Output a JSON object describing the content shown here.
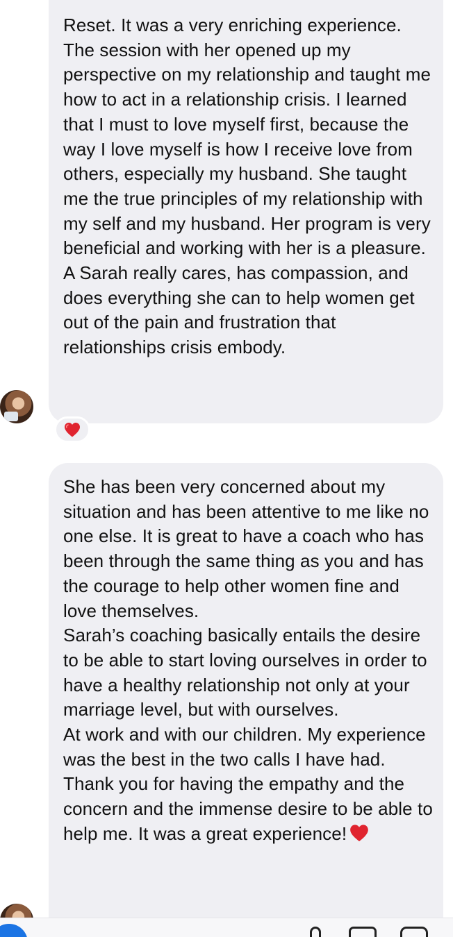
{
  "messages": [
    {
      "paragraphs": [
        "Reset. It was a very enriching experience. The session with her opened up my perspective on my relationship and taught me how to act in a relationship crisis. I learned that I must to love myself first, because the way I love myself is how I receive love from others, especially my husband. She taught me the true principles of my relationship with my self and my husband. Her program is very beneficial and working with her is a pleasure. A Sarah really cares, has compassion, and does everything she can to help women get out of the pain and frustration that relationships crisis embody."
      ],
      "reaction_icon": "red-heart-icon"
    },
    {
      "paragraphs": [
        "She has been very concerned about my situation and has been attentive to me like no one else. It is great to have a coach who has been through the same thing as you and has the courage to help other women fine and love themselves.",
        "Sarah’s coaching basically entails the desire to be able to start loving ourselves in order to have a healthy relationship not only at your marriage level, but with ourselves.",
        "At work and with our children. My experience was the best in the two calls I have had. Thank you for having the empathy and the concern and the immense desire to be able to help me. It was a great experience!"
      ],
      "trailing_icon": "red-heart-icon"
    }
  ],
  "colors": {
    "bubble_background": "#efeff3",
    "heart": "#e0242f",
    "app_button": "#1b74e4"
  },
  "icons": {
    "avatar": "sender-avatar",
    "composer": [
      "app-button",
      "microphone-icon",
      "photo-icon",
      "sticker-icon"
    ]
  }
}
